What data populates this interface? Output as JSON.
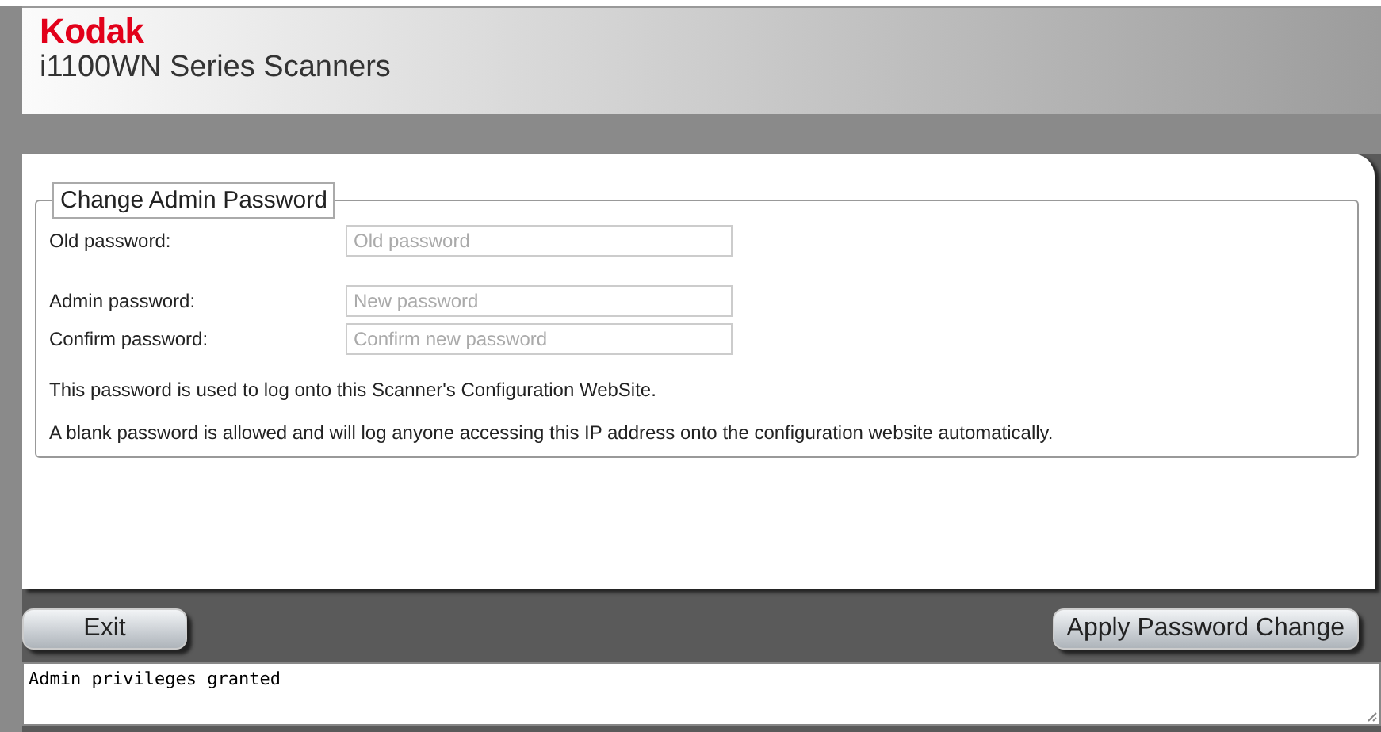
{
  "header": {
    "brand": "Kodak",
    "product": "i1100WN Series Scanners"
  },
  "form": {
    "legend": "Change Admin Password",
    "field_groups": [
      [
        {
          "label": "Old password:",
          "placeholder": "Old password"
        }
      ],
      [
        {
          "label": "Admin password:",
          "placeholder": "New password"
        },
        {
          "label": "Confirm password:",
          "placeholder": "Confirm new password"
        }
      ]
    ],
    "notes": [
      "This password is used to log onto this Scanner's Configuration WebSite.",
      "A blank password is allowed and will log anyone accessing this IP address onto the configuration website automatically."
    ]
  },
  "buttons": {
    "left": "Exit",
    "right": "Apply Password Change"
  },
  "status": {
    "text": "Admin privileges granted"
  }
}
